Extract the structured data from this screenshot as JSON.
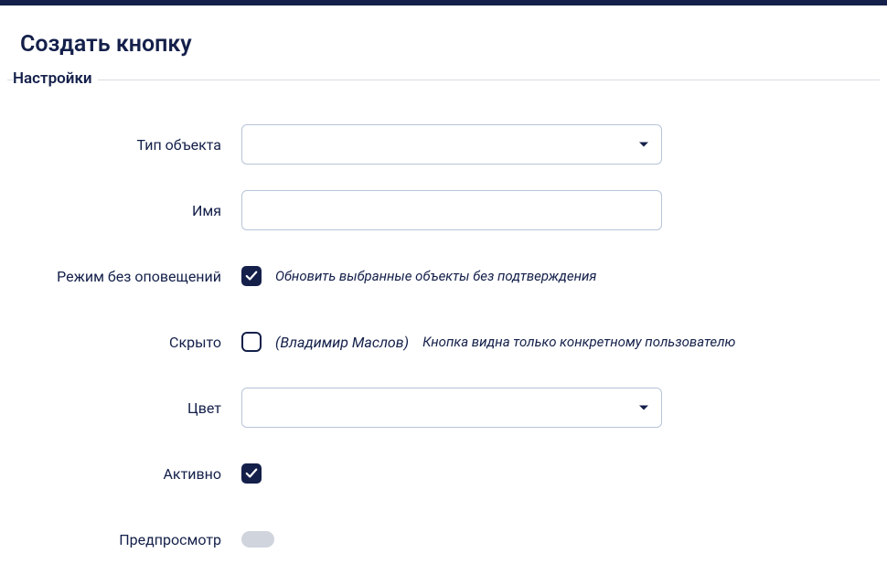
{
  "header": {
    "title": "Создать кнопку"
  },
  "fieldset": {
    "legend": "Настройки"
  },
  "form": {
    "object_type": {
      "label": "Тип объекта",
      "value": ""
    },
    "name": {
      "label": "Имя",
      "value": ""
    },
    "silent_mode": {
      "label": "Режим без оповещений",
      "checked": true,
      "hint": "Обновить выбранные объекты без подтверждения"
    },
    "hidden": {
      "label": "Скрыто",
      "checked": false,
      "user": "(Владимир Маслов)",
      "hint": "Кнопка видна только конкретному пользователю"
    },
    "color": {
      "label": "Цвет",
      "value": ""
    },
    "active": {
      "label": "Активно",
      "checked": true
    },
    "preview": {
      "label": "Предпросмотр"
    }
  }
}
